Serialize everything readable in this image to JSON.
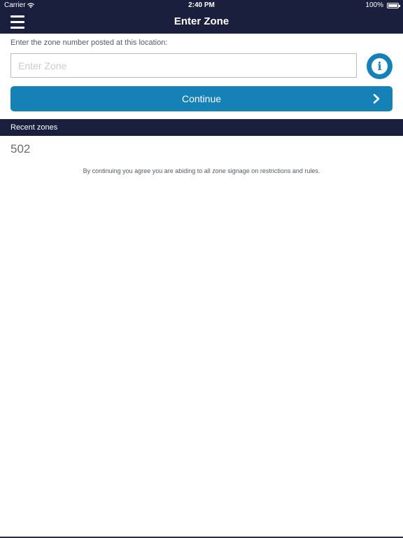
{
  "status_bar": {
    "carrier": "Carrier",
    "time": "2:40 PM",
    "battery": "100%"
  },
  "nav": {
    "title": "Enter Zone",
    "menu_icon": "hamburger-menu-icon"
  },
  "form": {
    "prompt": "Enter the zone number posted at this location:",
    "zone_placeholder": "Enter Zone",
    "zone_value": "",
    "info_icon": "info-icon",
    "continue_label": "Continue",
    "continue_icon": "chevron-right-icon"
  },
  "recent": {
    "header": "Recent zones",
    "items": [
      "502"
    ]
  },
  "disclaimer": "By continuing you agree you are abiding to all zone signage on restrictions and rules.",
  "colors": {
    "nav_bg": "#1a1f3e",
    "accent": "#1681b7",
    "text_muted": "#555a66"
  }
}
